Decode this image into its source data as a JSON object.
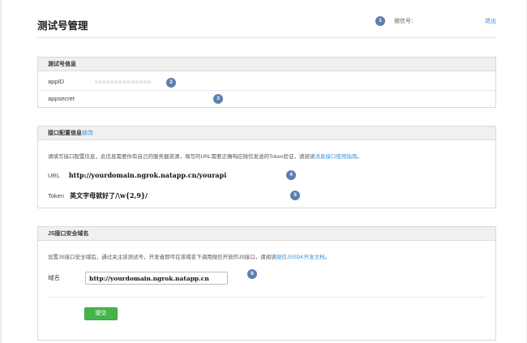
{
  "header": {
    "title": "测试号管理",
    "wechat_label": "微信号：",
    "logout_label": "退出"
  },
  "badges": [
    "1",
    "2",
    "3",
    "4",
    "5",
    "6"
  ],
  "test_account": {
    "section_title": "测试号信息",
    "appid_label": "appID",
    "appsecret_label": "appsecret"
  },
  "interface_config": {
    "section_title": "接口配置信息",
    "edit_label": "修改",
    "description": "请填写接口配置信息，此信息需要你有自己的服务器资源，填写的URL需要正确响应微信发送的Token验证，请阅读",
    "description_link": "消息接口使用指南",
    "description_end": "。",
    "url_label": "URL",
    "url_value": "http://yourdomain.ngrok.natapp.cn/yourapi",
    "token_label": "Token",
    "token_value": "英文字母就好了/\\w{2,9}/"
  },
  "js_security": {
    "section_title": "JS接口安全域名",
    "description": "设置JS接口安全域后，通过关注该测试号，开发者即可在该域名下调用微信开放的JS接口，请阅读",
    "description_link": "微信JSSDK开发文档",
    "description_end": "。",
    "domain_label": "域名",
    "domain_value": "http://yourdomain.ngrok.natapp.cn",
    "submit_label": "提交"
  },
  "colors": {
    "accent_link": "#3a8fd9",
    "badge": "#5a7fb0",
    "submit": "#44b549"
  }
}
